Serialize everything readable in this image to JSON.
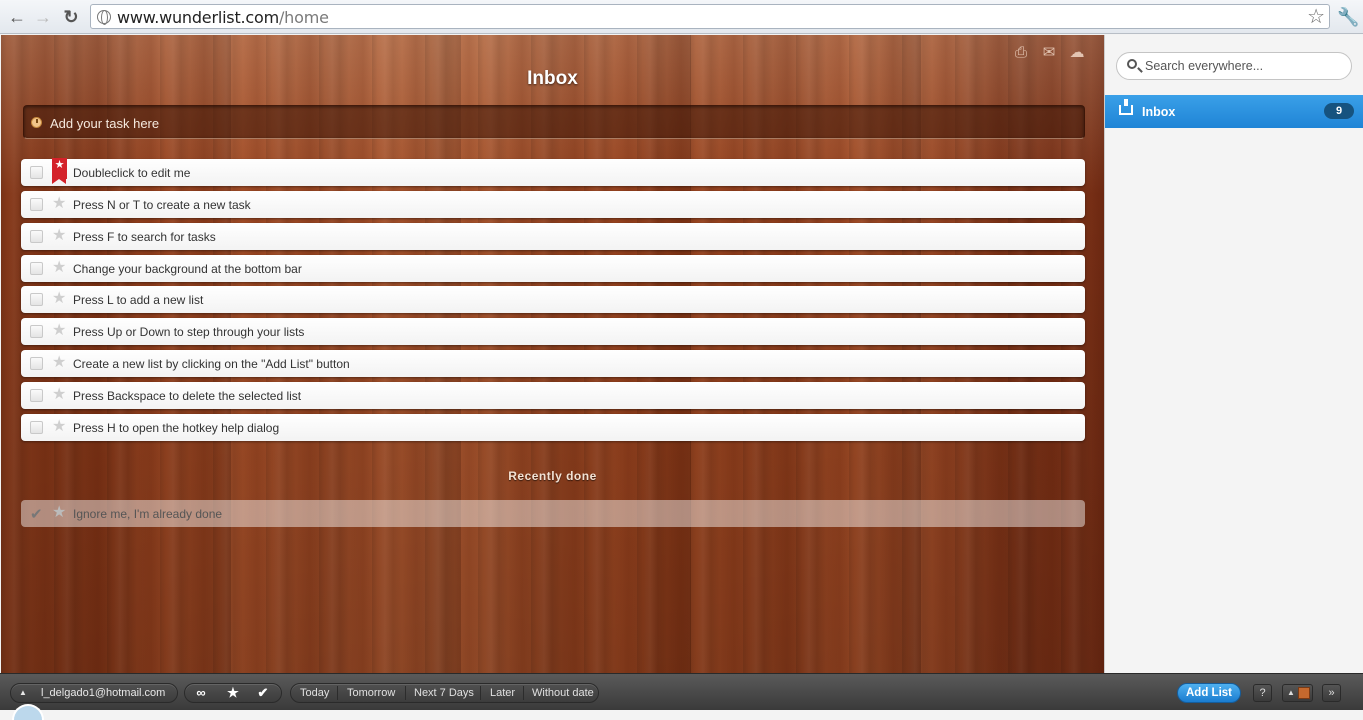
{
  "browser": {
    "url_host": "www.wunderlist.com",
    "url_path": "/home"
  },
  "main": {
    "title": "Inbox",
    "add_task_placeholder": "Add your task here",
    "tasks": [
      {
        "text": "Doubleclick to edit me",
        "starred": true
      },
      {
        "text": "Press N or T to create a new task",
        "starred": false
      },
      {
        "text": "Press F to search for tasks",
        "starred": false
      },
      {
        "text": "Change your background at the bottom bar",
        "starred": false
      },
      {
        "text": "Press L to add a new list",
        "starred": false
      },
      {
        "text": "Press Up or Down to step through your lists",
        "starred": false
      },
      {
        "text": "Create a new list by clicking on the \"Add List\" button",
        "starred": false
      },
      {
        "text": "Press Backspace to delete the selected list",
        "starred": false
      },
      {
        "text": "Press H to open the hotkey help dialog",
        "starred": false
      }
    ],
    "recently_done_title": "Recently done",
    "done_tasks": [
      {
        "text": "Ignore me, I'm already done"
      }
    ]
  },
  "sidebar": {
    "search_placeholder": "Search everywhere...",
    "lists": [
      {
        "label": "Inbox",
        "count": "9",
        "selected": true
      }
    ]
  },
  "bottom_bar": {
    "user_email": "l_delgado1@hotmail.com",
    "filters": [
      "Today",
      "Tomorrow",
      "Next 7 Days",
      "Later",
      "Without date"
    ],
    "add_list_label": "Add List",
    "help_label": "?",
    "more_label": "»"
  },
  "colors": {
    "accent": "#1f84d6",
    "star_flag": "#d4222a",
    "count_badge": "#16537f"
  }
}
